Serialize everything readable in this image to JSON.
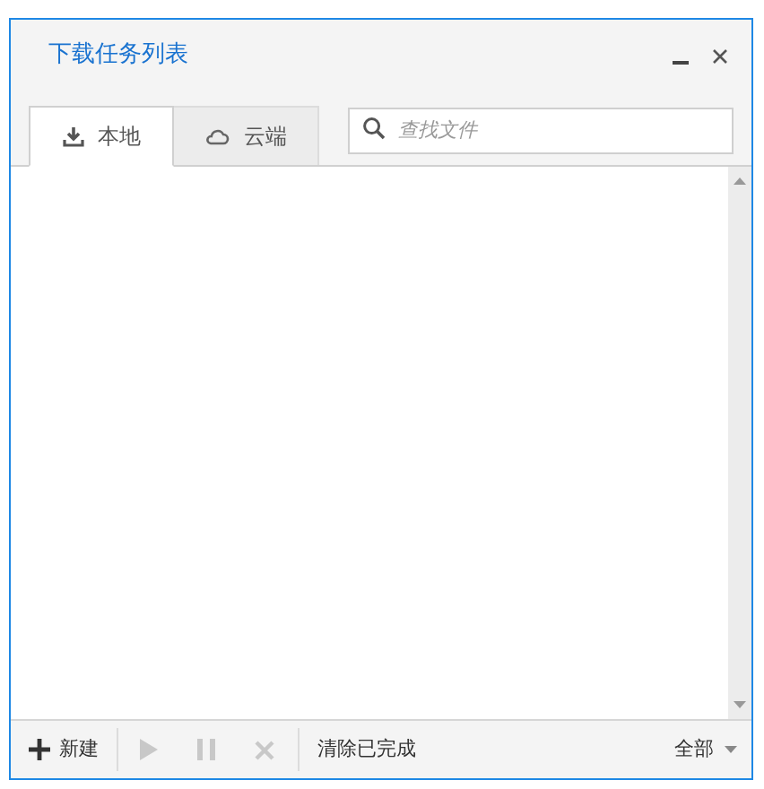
{
  "window": {
    "title": "下载任务列表"
  },
  "tabs": [
    {
      "label": "本地",
      "kind": "download",
      "selected": true
    },
    {
      "label": "云端",
      "kind": "cloud",
      "selected": false
    }
  ],
  "search": {
    "placeholder": "查找文件"
  },
  "toolbar": {
    "new_label": "新建",
    "play_disabled": true,
    "pause_disabled": true,
    "delete_disabled": true,
    "clear_label": "清除已完成",
    "filter": "全部"
  }
}
